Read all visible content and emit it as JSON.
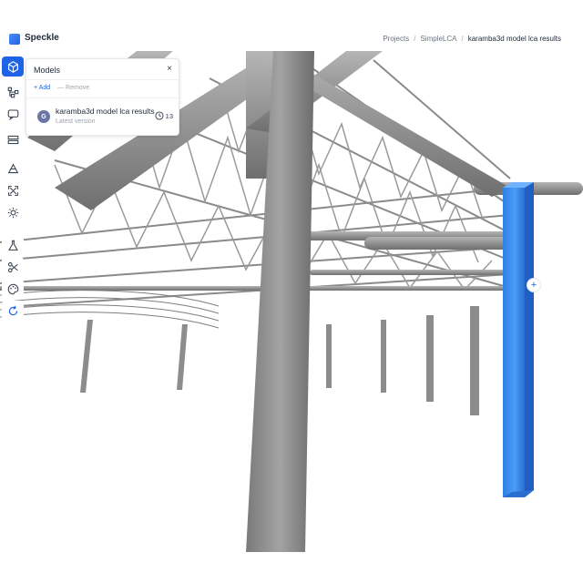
{
  "app": {
    "name": "Speckle"
  },
  "breadcrumb": {
    "items": [
      "Projects",
      "SimpleLCA",
      "karamba3d model lca results"
    ]
  },
  "toolbar": {
    "buttons": [
      {
        "icon": "cube-icon"
      },
      {
        "icon": "explorer-icon"
      },
      {
        "icon": "comments-icon"
      },
      {
        "icon": "layers-icon"
      },
      {
        "icon": "measure-icon"
      },
      {
        "icon": "zoom-extents-icon"
      },
      {
        "icon": "light-icon"
      },
      {
        "icon": "flask-icon"
      },
      {
        "icon": "scissors-icon"
      },
      {
        "icon": "palette-icon"
      },
      {
        "icon": "refresh-icon"
      }
    ]
  },
  "models_panel": {
    "title": "Models",
    "close": "×",
    "add_label": "+ Add",
    "remove_label": "— Remove",
    "item": {
      "avatar_letter": "G",
      "name": "karamba3d model lca results",
      "subtitle": "Latest version",
      "version_count": "13"
    }
  },
  "viewport": {
    "plus_label": "+",
    "highlight_color": "#3c8ef0",
    "steel_color": "#8f8f8f"
  }
}
